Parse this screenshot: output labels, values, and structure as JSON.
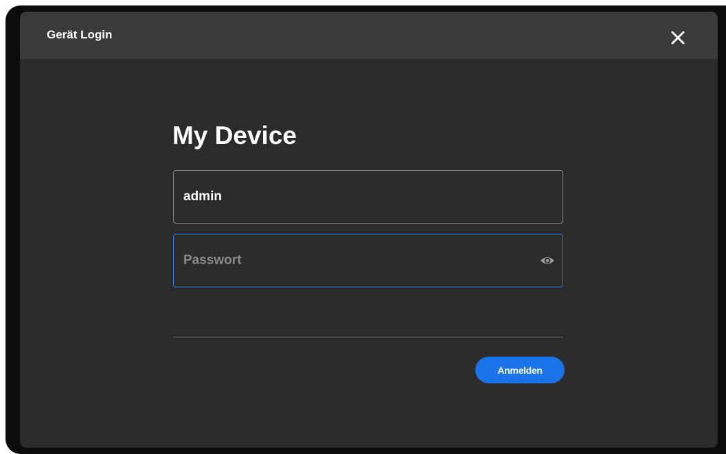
{
  "dialog": {
    "title": "Gerät Login",
    "close_icon": "close-icon"
  },
  "form": {
    "device_name": "My Device",
    "username": {
      "value": "admin",
      "placeholder": ""
    },
    "password": {
      "value": "",
      "placeholder": "Passwort",
      "visibility_icon": "eye-icon"
    },
    "submit_label": "Anmelden"
  },
  "colors": {
    "accent": "#1a73e8",
    "focus_border": "#2f7fe6",
    "dialog_background": "#2b2b2b",
    "header_background": "#3a3a3a",
    "frame_background": "#0b0b0b"
  }
}
